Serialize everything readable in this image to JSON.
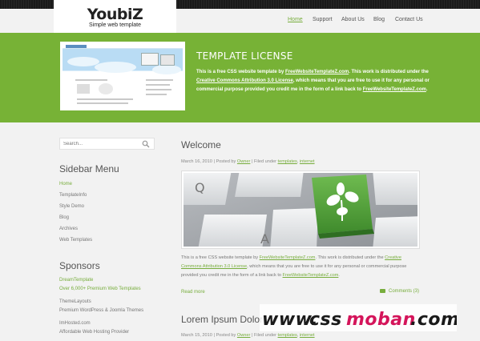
{
  "site": {
    "title": "YoubiZ",
    "tagline": "Simple web template"
  },
  "nav": {
    "items": [
      {
        "label": "Home",
        "active": true
      },
      {
        "label": "Support"
      },
      {
        "label": "About Us"
      },
      {
        "label": "Blog"
      },
      {
        "label": "Contact Us"
      }
    ]
  },
  "banner": {
    "title": "TEMPLATE LICENSE",
    "line1_prefix": "This is a free CSS website template by ",
    "line1_link": "FreeWebsiteTemplateZ.com",
    "line1_suffix": ". This work is distributed under the",
    "line2_link": "Creative Commons Attribution 3.0 License",
    "line2_suffix": ", which means that you are free to use it for any personal or",
    "line3_prefix": "commercial purpose provided you credit me in the form of a link back to ",
    "line3_link": "FreeWebsiteTemplateZ.com",
    "line3_suffix": "."
  },
  "search": {
    "placeholder": "Search..."
  },
  "sidebar": {
    "menu_heading": "Sidebar Menu",
    "menu_items": [
      {
        "label": "Home",
        "current": true
      },
      {
        "label": "TemplateInfo"
      },
      {
        "label": "Style Demo"
      },
      {
        "label": "Blog"
      },
      {
        "label": "Archives"
      },
      {
        "label": "Web Templates"
      }
    ],
    "sponsors_heading": "Sponsors",
    "sponsors": [
      {
        "name": "DreamTemplate",
        "desc": "Over 6,000+ Premium Web Templates",
        "highlight": true
      },
      {
        "name": "ThemeLayouts",
        "desc": "Premium WordPress & Joomla Themes",
        "highlight": false
      },
      {
        "name": "ImHosted.com",
        "desc": "Affordable Web Hosting Provider",
        "highlight": false
      }
    ]
  },
  "posts": [
    {
      "title": "Welcome",
      "date": "March 16, 2010",
      "posted_by": "Posted by",
      "author": "Owner",
      "filed": "Filed under",
      "cat1": "templates",
      "cat2": "internet",
      "excerpt_l1_prefix": "This is a free CSS website template by ",
      "excerpt_l1_link": "FreeWebsiteTemplateZ.com",
      "excerpt_l1_mid": ". This work is distributed under the ",
      "excerpt_l1_link2": "Creative",
      "excerpt_l2_link": "Commons Attribution 3.0 License",
      "excerpt_l2_suffix": ", which means that you are free to use it for any personal or commercial purpose",
      "excerpt_l3_prefix": "provided you credit me in the form of a link back to ",
      "excerpt_l3_link": "FreeWebsiteTemplateZ.com",
      "excerpt_l3_suffix": ".",
      "read_more": "Read more",
      "comments": "Comments (3)"
    },
    {
      "title": "Lorem Ipsum Dolor",
      "date": "March 15, 2010",
      "posted_by": "Posted by",
      "author": "Owner",
      "filed": "Filed under",
      "cat1": "templates",
      "cat2": "internet"
    }
  ],
  "watermark": "www.cssmoban.com",
  "colors": {
    "accent": "#77b236",
    "link": "#77ad3c",
    "background": "#f2f2f2",
    "watermark_pink": "#d4145a"
  }
}
